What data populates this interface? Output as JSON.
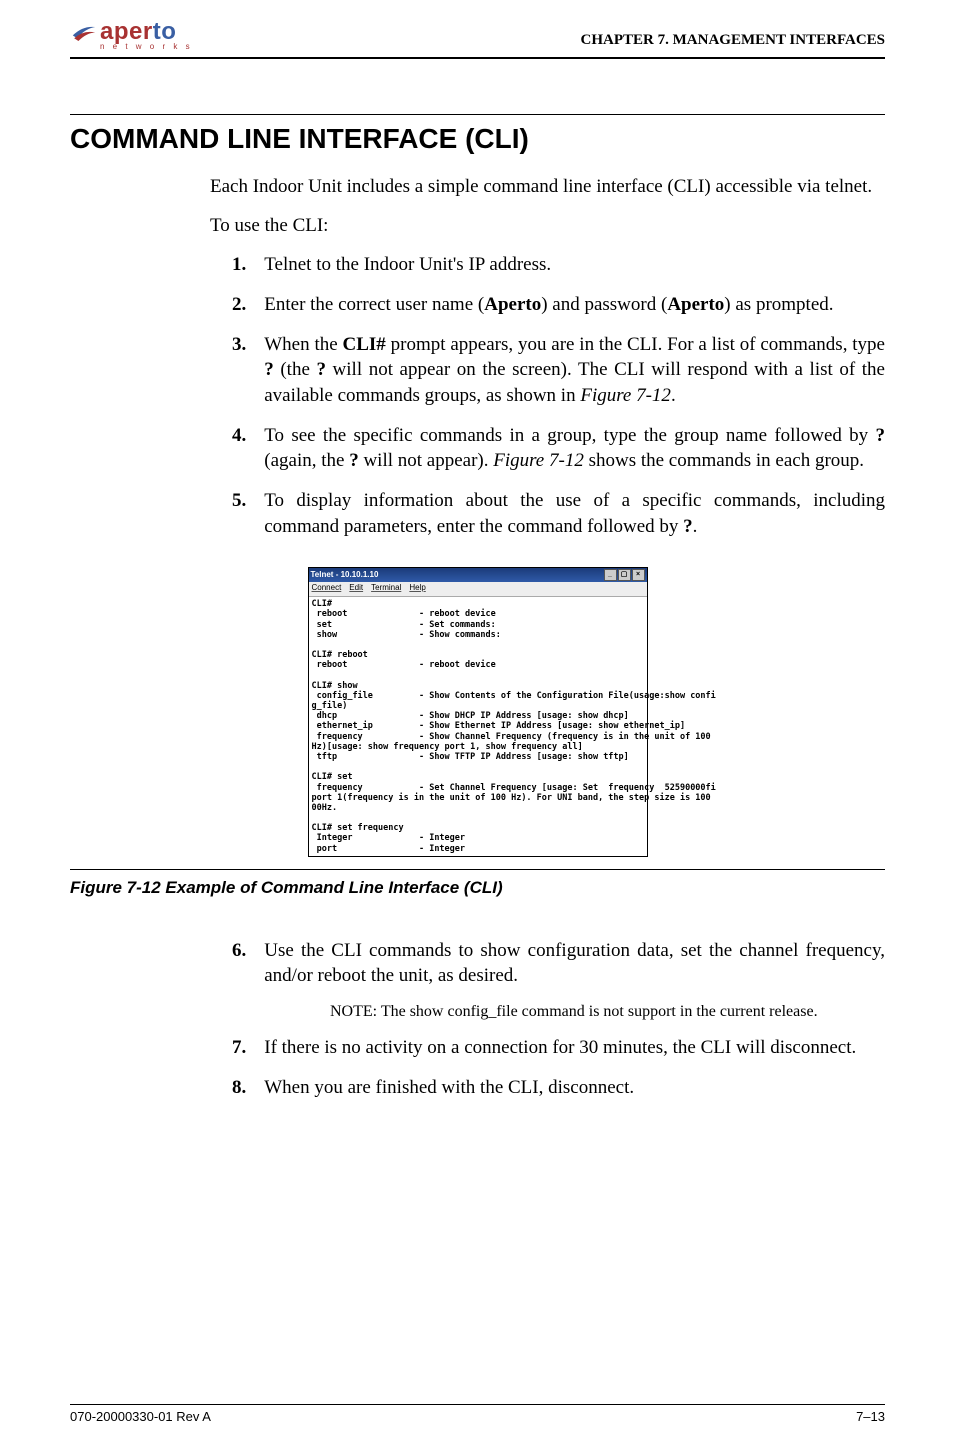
{
  "header": {
    "logo_main_a": "aper",
    "logo_main_b": "to",
    "logo_sub": "n e t w o r k s",
    "chapter": "CHAPTER 7.  MANAGEMENT INTERFACES"
  },
  "section": {
    "title": "COMMAND LINE INTERFACE (CLI)",
    "intro": "Each Indoor Unit includes a simple command line interface (CLI) accessible via telnet.",
    "lead": "To use the CLI:"
  },
  "steps": {
    "s1": "Telnet to the Indoor Unit's IP address.",
    "s2_a": "Enter the correct user name (",
    "s2_b": "Aperto",
    "s2_c": ") and password (",
    "s2_d": "Aperto",
    "s2_e": ") as prompted.",
    "s3_a": "When the ",
    "s3_b": "CLI#",
    "s3_c": " prompt appears, you are in the CLI. For a list of commands, type ",
    "s3_d": "?",
    "s3_e": " (the ",
    "s3_f": "?",
    "s3_g": " will not appear on the screen). The CLI will respond with a list of the available commands groups, as shown in ",
    "s3_h": "Figure 7-12",
    "s3_i": ".",
    "s4_a": "To see the specific commands in a group, type the group name followed by ",
    "s4_b": "?",
    "s4_c": " (again, the ",
    "s4_d": "?",
    "s4_e": " will not appear). ",
    "s4_f": "Figure 7-12",
    "s4_g": " shows the commands in each group.",
    "s5_a": "To display information about the use of a specific commands, including command parameters, enter the command followed by ",
    "s5_b": "?",
    "s5_c": ".",
    "s6": "Use the CLI commands to show configuration data, set the channel frequency, and/or reboot the unit, as desired.",
    "s7": "If there is no activity on a connection for 30 minutes, the CLI will disconnect.",
    "s8": "When you are finished with the CLI, disconnect."
  },
  "note": "NOTE:  The show config_file command is not support in the current release.",
  "terminal": {
    "title": "Telnet - 10.10.1.10",
    "menu": {
      "m1": "Connect",
      "m2": "Edit",
      "m3": "Terminal",
      "m4": "Help"
    },
    "body": "CLI#\n reboot              - reboot device\n set                 - Set commands:\n show                - Show commands:\n\nCLI# reboot\n reboot              - reboot device\n\nCLI# show\n config_file         - Show Contents of the Configuration File(usage:show confi\ng_file)\n dhcp                - Show DHCP IP Address [usage: show dhcp]\n ethernet_ip         - Show Ethernet IP Address [usage: show ethernet_ip]\n frequency           - Show Channel Frequency (frequency is in the unit of 100\nHz)[usage: show frequency port 1, show frequency all]\n tftp                - Show TFTP IP Address [usage: show tftp]\n\nCLI# set\n frequency           - Set Channel Frequency [usage: Set  frequency  52590000fi\nport 1(frequency is in the unit of 100 Hz). For UNI band, the step size is 100\n00Hz.\n\nCLI# set frequency\n Integer             - Integer\n port                - Integer"
  },
  "figure": {
    "caption": "Figure 7-12      Example of Command Line Interface (CLI)"
  },
  "footer": {
    "left": "070-20000330-01 Rev A",
    "right": "7–13"
  }
}
